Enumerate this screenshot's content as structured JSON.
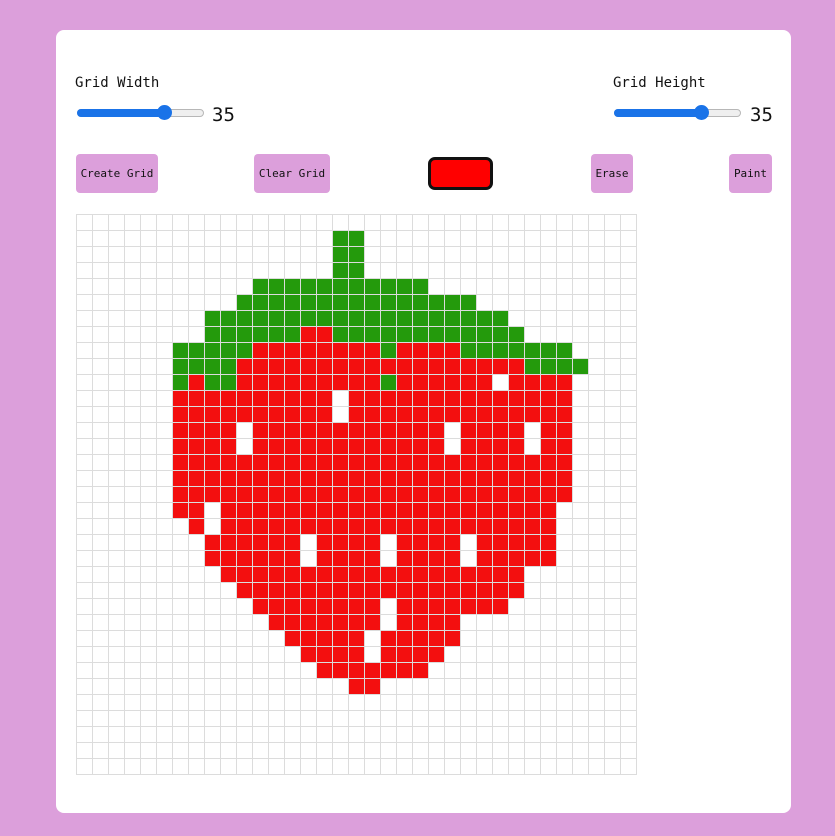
{
  "width_control": {
    "label": "Grid Width",
    "value": "35",
    "min": 1,
    "max": 50
  },
  "height_control": {
    "label": "Grid Height",
    "value": "35",
    "min": 1,
    "max": 50
  },
  "toolbar": {
    "create_label": "Create Grid",
    "clear_label": "Clear Grid",
    "erase_label": "Erase",
    "paint_label": "Paint"
  },
  "current_color": "#ff0000",
  "colors": {
    "page_bg": "#dc9fdb",
    "red": "#f30f0f",
    "green": "#249a0c",
    "empty": "#ffffff"
  },
  "grid": {
    "cols": 35,
    "rows": 35,
    "pixels": [
      "...................................",
      "................gg.................",
      "................gg.................",
      "................gg.................",
      "...........ggggggggggg.............",
      "..........ggggggggggggggg..........",
      "........ggggggggggggggggggg........",
      "........ggggggrrgggggggggggg.......",
      "......gggggrrrrrrrrgrrrrggggggg....",
      "......ggggrrrrrrrrrrrrrrrrrrgggg...",
      "......grggrrrrrrrrrgrrrrrr.rrrr....",
      "......rrrrrrrrrr.rrrrrrrrrrrrrr....",
      "......rrrrrrrrrr.rrrrrrrrrrrrrr....",
      "......rrrr.rrrrrrrrrrrr.rrrr.rr....",
      "......rrrr.rrrrrrrrrrrr.rrrr.rr....",
      "......rrrrrrrrrrrrrrrrrrrrrrrrr....",
      "......rrrrrrrrrrrrrrrrrrrrrrrrr....",
      "......rrrrrrrrrrrrrrrrrrrrrrrrr....",
      "......rr.rrrrrrrrrrrrrrrrrrrrr.....",
      ".......r.rrrrrrrrrrrrrrrrrrrrr.....",
      "........rrrrrr.rrrr.rrrr.rrrrr.....",
      "........rrrrrr.rrrr.rrrr.rrrrr.....",
      ".........rrrrrrrrrrrrrrrrrrr.......",
      "..........rrrrrrrrrrrrrrrrrr.......",
      "...........rrrrrrrr.rrrrrrr........",
      "............rrrrrrr.rrrr...........",
      ".............rrrrr.rrrrr...........",
      "..............rrrr.rrrr............",
      "...............rrrrrrr.............",
      ".................rr................",
      "...................................",
      "...................................",
      "...................................",
      "...................................",
      "..................................."
    ]
  }
}
